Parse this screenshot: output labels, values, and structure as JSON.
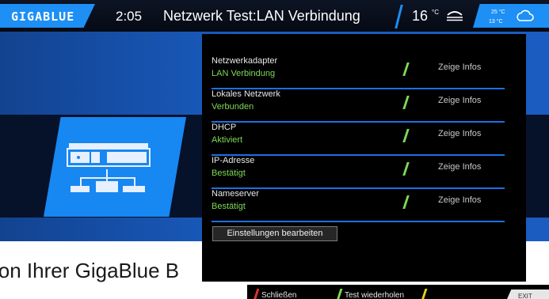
{
  "header": {
    "logo": "GIGABLUE",
    "time": "2:05",
    "title": "Netzwerk Test:LAN Verbindung",
    "temperature": "16",
    "temperature_unit": "°C",
    "temp_high": "25 °C",
    "temp_low": "13 °C",
    "weather_icon": "cloud-icon",
    "accent_color": "#1d8ff5"
  },
  "tests": [
    {
      "label": "Netzwerkadapter",
      "value": "LAN Verbindung",
      "action": "Zeige Infos"
    },
    {
      "label": "Lokales Netzwerk",
      "value": "Verbunden",
      "action": "Zeige Infos"
    },
    {
      "label": "DHCP",
      "value": "Aktiviert",
      "action": "Zeige Infos"
    },
    {
      "label": "IP-Adresse",
      "value": "Bestätigt",
      "action": "Zeige Infos"
    },
    {
      "label": "Nameserver",
      "value": "Bestätigt",
      "action": "Zeige Infos"
    }
  ],
  "status_color": "#7ed957",
  "edit_button": "Einstellungen bearbeiten",
  "caption": "ion Ihrer GigaBlue B",
  "footer": {
    "red": {
      "label": "Schließen",
      "color": "#e03030"
    },
    "green": {
      "label": "Test wiederholen",
      "color": "#7ed957"
    },
    "yellow": {
      "label": "",
      "color": "#e8d020"
    },
    "exit": "EXIT"
  }
}
